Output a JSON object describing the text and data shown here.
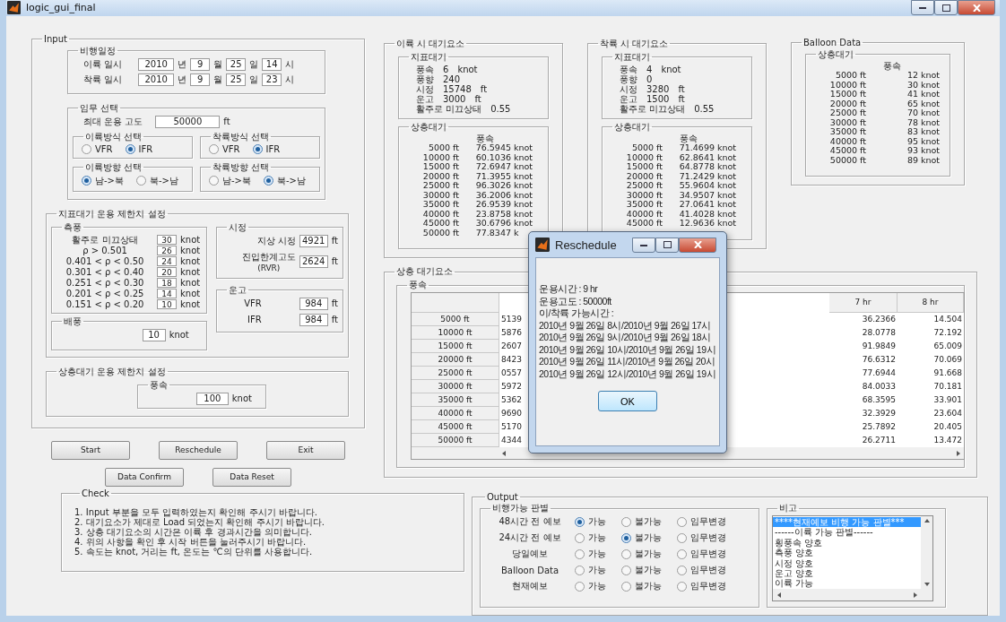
{
  "window": {
    "title": "logic_gui_final"
  },
  "input": {
    "title": "Input",
    "schedule": {
      "title": "비행일정",
      "rows": [
        {
          "label": "이륙 일시",
          "fields": [
            {
              "value": "2010",
              "unit": "년"
            },
            {
              "value": "9",
              "unit": "월"
            },
            {
              "value": "25",
              "unit": "일"
            },
            {
              "value": "14",
              "unit": "시"
            }
          ]
        },
        {
          "label": "착륙 일시",
          "fields": [
            {
              "value": "2010",
              "unit": "년"
            },
            {
              "value": "9",
              "unit": "월"
            },
            {
              "value": "25",
              "unit": "일"
            },
            {
              "value": "23",
              "unit": "시"
            }
          ]
        }
      ]
    },
    "mission": {
      "title": "임무 선택",
      "altitude": {
        "label": "최대 운용 고도",
        "value": "50000",
        "unit": "ft"
      },
      "groups": [
        {
          "title": "이륙방식 선택",
          "options": [
            {
              "label": "VFR",
              "selected": false
            },
            {
              "label": "IFR",
              "selected": true
            }
          ]
        },
        {
          "title": "착륙방식 선택",
          "options": [
            {
              "label": "VFR",
              "selected": false
            },
            {
              "label": "IFR",
              "selected": true
            }
          ]
        },
        {
          "title": "이륙방향 선택",
          "options": [
            {
              "label": "남->북",
              "selected": true
            },
            {
              "label": "북->남",
              "selected": false
            }
          ]
        },
        {
          "title": "착륙방향 선택",
          "options": [
            {
              "label": "남->북",
              "selected": false
            },
            {
              "label": "북->남",
              "selected": true
            }
          ]
        }
      ]
    },
    "surface_limits": {
      "title": "지표대기 운용 제한치 설정",
      "crosswind": {
        "title": "측풍",
        "rows": [
          {
            "label": "활주로 미끄상태",
            "value": "30",
            "unit": "knot"
          },
          {
            "label": "ρ > 0.501",
            "value": "26",
            "unit": "knot"
          },
          {
            "label": "0.401 < ρ < 0.50",
            "value": "24",
            "unit": "knot"
          },
          {
            "label": "0.301 < ρ < 0.40",
            "value": "20",
            "unit": "knot"
          },
          {
            "label": "0.251 < ρ < 0.30",
            "value": "18",
            "unit": "knot"
          },
          {
            "label": "0.201 < ρ < 0.25",
            "value": "14",
            "unit": "knot"
          },
          {
            "label": "0.151 < ρ < 0.20",
            "value": "10",
            "unit": "knot"
          }
        ]
      },
      "tailwind": {
        "title": "배풍",
        "value": "10",
        "unit": "knot"
      },
      "visibility": {
        "title": "시정",
        "rows": [
          {
            "label": "지상 시정",
            "value": "4921",
            "unit": "ft"
          },
          {
            "label": "진입한계고도",
            "note": "(RVR)",
            "value": "2624",
            "unit": "ft"
          }
        ]
      },
      "ceiling": {
        "title": "운고",
        "rows": [
          {
            "label": "VFR",
            "value": "984",
            "unit": "ft"
          },
          {
            "label": "IFR",
            "value": "984",
            "unit": "ft"
          }
        ]
      }
    },
    "upper_limits": {
      "title": "상층대기 운용 제한치 설정",
      "wind": {
        "title": "풍속",
        "value": "100",
        "unit": "knot"
      }
    }
  },
  "button_rows": [
    {
      "buttons": [
        "Start",
        "Reschedule",
        "Exit"
      ]
    },
    {
      "buttons": [
        "Data Confirm",
        "Data Reset"
      ]
    }
  ],
  "check": {
    "title": "Check",
    "lines": [
      "1. Input 부분을 모두 입력하였는지 확인해 주시기 바랍니다.",
      "2. 대기요소가 제대로 Load 되었는지 확인해 주시기 바랍니다.",
      "3. 상층 대기요소의 시간은 이륙 후 경과시간을 의미합니다.",
      "4. 위의 사항을 확인 후 시작 버튼을 눌러주시기 바랍니다.",
      "5. 속도는 knot, 거리는 ft, 온도는 ℃의 단위를 사용합니다."
    ]
  },
  "weather_panels": [
    {
      "title": "이륙 시 대기요소",
      "surface": {
        "title": "지표대기",
        "rows": [
          {
            "label": "풍속",
            "value": "6",
            "unit": "knot"
          },
          {
            "label": "풍향",
            "value": "240"
          },
          {
            "label": "시정",
            "value": "15748",
            "unit": "ft"
          },
          {
            "label": "운고",
            "value": "3000",
            "unit": "ft"
          },
          {
            "label": "활주로 미끄상태",
            "value": "0.55"
          }
        ]
      },
      "upper": {
        "title": "상층대기",
        "header": "풍속",
        "rows": [
          {
            "altitude": "5000 ft",
            "value": "76.5945",
            "unit": "knot"
          },
          {
            "altitude": "10000 ft",
            "value": "60.1036",
            "unit": "knot"
          },
          {
            "altitude": "15000 ft",
            "value": "72.6947",
            "unit": "knot"
          },
          {
            "altitude": "20000 ft",
            "value": "71.3955",
            "unit": "knot"
          },
          {
            "altitude": "25000 ft",
            "value": "96.3026",
            "unit": "knot"
          },
          {
            "altitude": "30000 ft",
            "value": "36.2006",
            "unit": "knot"
          },
          {
            "altitude": "35000 ft",
            "value": "26.9539",
            "unit": "knot"
          },
          {
            "altitude": "40000 ft",
            "value": "23.8758",
            "unit": "knot"
          },
          {
            "altitude": "45000 ft",
            "value": "30.6796",
            "unit": "knot"
          },
          {
            "altitude": "50000 ft",
            "value": "77.8347",
            "unit": "k"
          }
        ]
      }
    },
    {
      "title": "착륙 시 대기요소",
      "surface": {
        "title": "지표대기",
        "rows": [
          {
            "label": "풍속",
            "value": "4",
            "unit": "knot"
          },
          {
            "label": "풍향",
            "value": "0"
          },
          {
            "label": "시정",
            "value": "3280",
            "unit": "ft"
          },
          {
            "label": "운고",
            "value": "1500",
            "unit": "ft"
          },
          {
            "label": "활주로 미끄상태",
            "value": "0.55"
          }
        ]
      },
      "upper": {
        "title": "상층대기",
        "header": "풍속",
        "rows": [
          {
            "altitude": "5000 ft",
            "value": "71.4699",
            "unit": "knot"
          },
          {
            "altitude": "10000 ft",
            "value": "62.8641",
            "unit": "knot"
          },
          {
            "altitude": "15000 ft",
            "value": "64.8778",
            "unit": "knot"
          },
          {
            "altitude": "20000 ft",
            "value": "71.2429",
            "unit": "knot"
          },
          {
            "altitude": "25000 ft",
            "value": "55.9604",
            "unit": "knot"
          },
          {
            "altitude": "30000 ft",
            "value": "34.9507",
            "unit": "knot"
          },
          {
            "altitude": "35000 ft",
            "value": "27.0641",
            "unit": "knot"
          },
          {
            "altitude": "40000 ft",
            "value": "41.4028",
            "unit": "knot"
          },
          {
            "altitude": "45000 ft",
            "value": "12.9636",
            "unit": "knot"
          }
        ]
      }
    }
  ],
  "balloon": {
    "title": "Balloon Data",
    "upper": {
      "title": "상층대기",
      "header": "풍속",
      "rows": [
        {
          "altitude": "5000 ft",
          "value": "12",
          "unit": "knot"
        },
        {
          "altitude": "10000 ft",
          "value": "30",
          "unit": "knot"
        },
        {
          "altitude": "15000 ft",
          "value": "41",
          "unit": "knot"
        },
        {
          "altitude": "20000 ft",
          "value": "65",
          "unit": "knot"
        },
        {
          "altitude": "25000 ft",
          "value": "70",
          "unit": "knot"
        },
        {
          "altitude": "30000 ft",
          "value": "78",
          "unit": "knot"
        },
        {
          "altitude": "35000 ft",
          "value": "83",
          "unit": "knot"
        },
        {
          "altitude": "40000 ft",
          "value": "95",
          "unit": "knot"
        },
        {
          "altitude": "45000 ft",
          "value": "93",
          "unit": "knot"
        },
        {
          "altitude": "50000 ft",
          "value": "89",
          "unit": "knot"
        }
      ]
    }
  },
  "upper_table": {
    "title": "상층 대기요소",
    "subtitle": "풍속",
    "columns": [
      "7 hr",
      "8 hr"
    ],
    "rows": [
      {
        "altitude": "5000 ft",
        "column_1": "5139",
        "cells": [
          "36.2366",
          "14.504"
        ]
      },
      {
        "altitude": "10000 ft",
        "column_1": "5876",
        "cells": [
          "28.0778",
          "72.192"
        ]
      },
      {
        "altitude": "15000 ft",
        "column_1": "2607",
        "cells": [
          "91.9849",
          "65.009"
        ]
      },
      {
        "altitude": "20000 ft",
        "column_1": "8423",
        "cells": [
          "76.6312",
          "70.069"
        ]
      },
      {
        "altitude": "25000 ft",
        "column_1": "0557",
        "cells": [
          "77.6944",
          "91.668"
        ]
      },
      {
        "altitude": "30000 ft",
        "column_1": "5972",
        "cells": [
          "84.0033",
          "70.181"
        ]
      },
      {
        "altitude": "35000 ft",
        "column_1": "5362",
        "cells": [
          "68.3595",
          "33.901"
        ]
      },
      {
        "altitude": "40000 ft",
        "column_1": "9690",
        "cells": [
          "32.3929",
          "23.604"
        ]
      },
      {
        "altitude": "45000 ft",
        "column_1": "5170",
        "cells": [
          "25.7892",
          "20.405"
        ]
      },
      {
        "altitude": "50000 ft",
        "column_1": "4344",
        "cells": [
          "26.2711",
          "13.472"
        ]
      }
    ]
  },
  "output": {
    "title": "Output",
    "judgement": {
      "title": "비행가능 판별",
      "rows": [
        {
          "label": "48시간 전 예보",
          "options": [
            {
              "label": "가능",
              "selected": true
            },
            {
              "label": "불가능",
              "selected": false
            },
            {
              "label": "임무변경",
              "selected": false
            }
          ]
        },
        {
          "label": "24시간 전 예보",
          "options": [
            {
              "label": "가능",
              "selected": false
            },
            {
              "label": "불가능",
              "selected": true
            },
            {
              "label": "임무변경",
              "selected": false
            }
          ]
        },
        {
          "label": "당일예보",
          "options": [
            {
              "label": "가능",
              "selected": false
            },
            {
              "label": "불가능",
              "selected": false
            },
            {
              "label": "임무변경",
              "selected": false
            }
          ]
        },
        {
          "label": "Balloon Data",
          "options": [
            {
              "label": "가능",
              "selected": false
            },
            {
              "label": "불가능",
              "selected": false
            },
            {
              "label": "임무변경",
              "selected": false
            }
          ]
        },
        {
          "label": "현재예보",
          "options": [
            {
              "label": "가능",
              "selected": false
            },
            {
              "label": "불가능",
              "selected": false
            },
            {
              "label": "임무변경",
              "selected": false
            }
          ]
        }
      ]
    },
    "remarks": {
      "title": "비고",
      "items": [
        {
          "label": "****현재예보 비행 가능 판별***",
          "selected": true
        },
        {
          "label": "------이륙 가능 판별------",
          "selected": false
        },
        {
          "label": "횡풍속 양호",
          "selected": false
        },
        {
          "label": "측풍 양호",
          "selected": false
        },
        {
          "label": "시정 양호",
          "selected": false
        },
        {
          "label": "운고 양호",
          "selected": false
        },
        {
          "label": "이륙 가능",
          "selected": false
        }
      ]
    }
  },
  "dialog": {
    "title": "Reschedule",
    "lines": [
      "운용시간 : 9 hr",
      "운용고도 : 50000ft",
      "이/착륙 가능시간 :",
      "2010년 9월 26일 8시/2010년 9월 26일 17시",
      "2010년 9월 26일 9시/2010년 9월 26일 18시",
      "2010년 9월 26일 10시/2010년 9월 26일 19시",
      "2010년 9월 26일 11시/2010년 9월 26일 20시",
      "2010년 9월 26일 12시/2010년 9월 26일 19시"
    ],
    "button": "OK"
  }
}
